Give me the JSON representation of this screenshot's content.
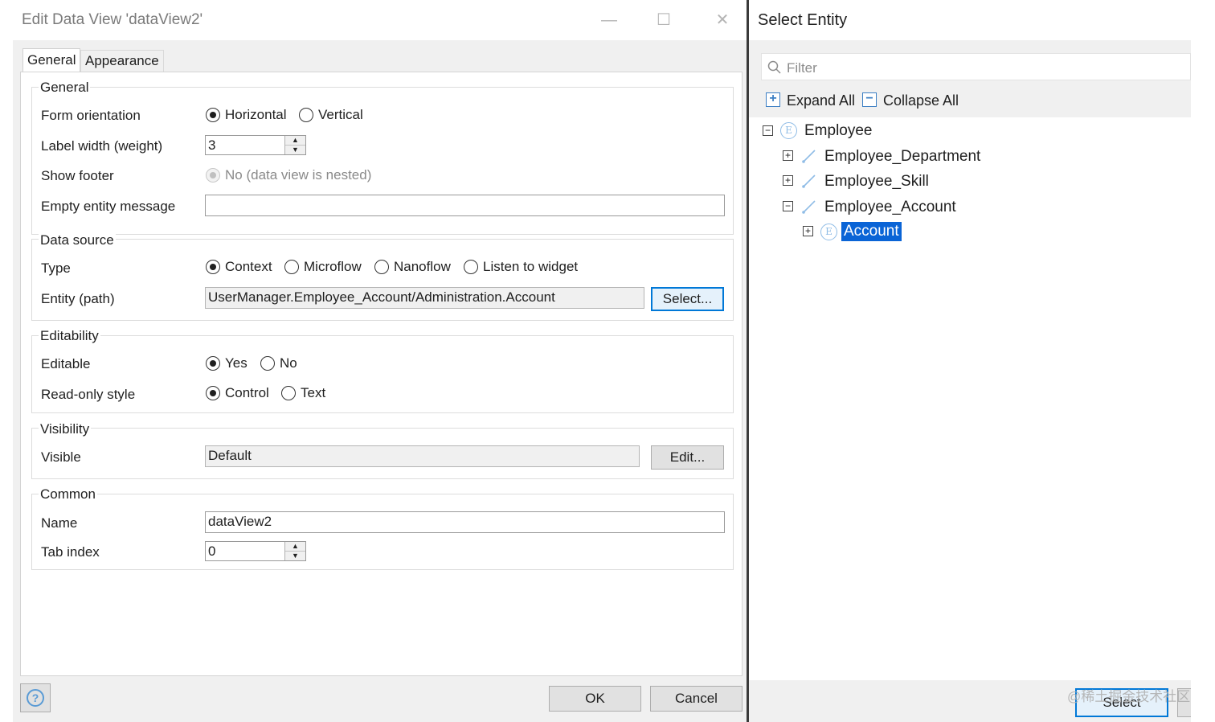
{
  "dialog": {
    "title": "Edit Data View 'dataView2'",
    "window_buttons": {
      "minimize": "—",
      "maximize": "☐",
      "close": "✕"
    },
    "tabs": [
      {
        "label": "General",
        "selected": true
      },
      {
        "label": "Appearance",
        "selected": false
      }
    ],
    "groups": {
      "general": {
        "title": "General",
        "form_orientation": {
          "label": "Form orientation",
          "options": [
            "Horizontal",
            "Vertical"
          ],
          "selected": "Horizontal"
        },
        "label_width": {
          "label": "Label width (weight)",
          "value": "3"
        },
        "show_footer": {
          "label": "Show footer",
          "option": "No (data view is nested)",
          "disabled": true
        },
        "empty_entity_message": {
          "label": "Empty entity message",
          "value": ""
        }
      },
      "data_source": {
        "title": "Data source",
        "type": {
          "label": "Type",
          "options": [
            "Context",
            "Microflow",
            "Nanoflow",
            "Listen to widget"
          ],
          "selected": "Context"
        },
        "entity_path": {
          "label": "Entity (path)",
          "value": "UserManager.Employee_Account/Administration.Account",
          "button": "Select..."
        }
      },
      "editability": {
        "title": "Editability",
        "editable": {
          "label": "Editable",
          "options": [
            "Yes",
            "No"
          ],
          "selected": "Yes"
        },
        "read_only_style": {
          "label": "Read-only style",
          "options": [
            "Control",
            "Text"
          ],
          "selected": "Control"
        }
      },
      "visibility": {
        "title": "Visibility",
        "visible": {
          "label": "Visible",
          "value": "Default",
          "button": "Edit..."
        }
      },
      "common": {
        "title": "Common",
        "name": {
          "label": "Name",
          "value": "dataView2"
        },
        "tab_index": {
          "label": "Tab index",
          "value": "0"
        }
      }
    },
    "footer": {
      "help_icon": "question-icon",
      "ok": "OK",
      "cancel": "Cancel"
    }
  },
  "select_entity": {
    "title": "Select Entity",
    "filter_placeholder": "Filter",
    "expand_all": "Expand All",
    "collapse_all": "Collapse All",
    "tree": {
      "root": {
        "label": "Employee",
        "expanded": true
      },
      "associations": [
        {
          "label": "Employee_Department",
          "expanded": false
        },
        {
          "label": "Employee_Skill",
          "expanded": false
        },
        {
          "label": "Employee_Account",
          "expanded": true
        }
      ],
      "selected_child": {
        "label": "Account",
        "selected": true
      }
    },
    "select_button": "Select"
  },
  "watermark": "@稀土掘金技术社区",
  "colors": {
    "selection": "#0a64d6",
    "default_button_border": "#0078d7",
    "entity_icon": "#8fbce6"
  }
}
